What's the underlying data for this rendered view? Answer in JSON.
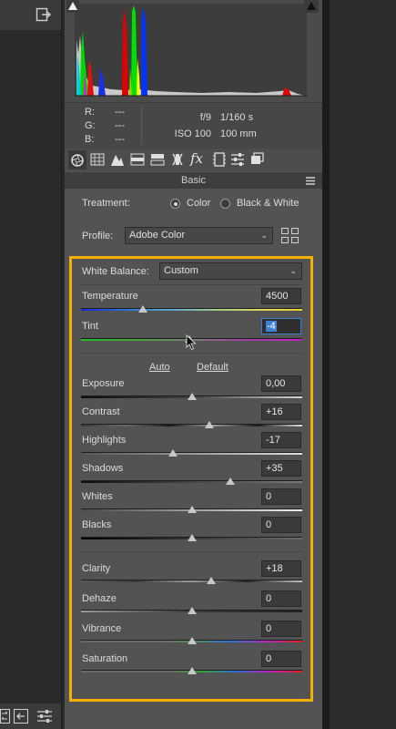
{
  "histogram_info": {
    "r_label": "R:",
    "g_label": "G:",
    "b_label": "B:",
    "r_value": "---",
    "g_value": "---",
    "b_value": "---",
    "aperture": "f/9",
    "shutter": "1/160 s",
    "iso": "ISO 100",
    "focal_length": "100 mm"
  },
  "panel": {
    "title": "Basic"
  },
  "treatment": {
    "label": "Treatment:",
    "color_option": "Color",
    "bw_option": "Black & White",
    "selected": "Color"
  },
  "profile": {
    "label": "Profile:",
    "value": "Adobe Color"
  },
  "white_balance": {
    "label": "White Balance:",
    "value": "Custom"
  },
  "sliders": {
    "temperature": {
      "label": "Temperature",
      "value": "4500",
      "level": 0.28
    },
    "tint": {
      "label": "Tint",
      "value": "-4",
      "level": 0.49
    },
    "exposure": {
      "label": "Exposure",
      "value": "0,00",
      "level": 0.5
    },
    "contrast": {
      "label": "Contrast",
      "value": "+16",
      "level": 0.58
    },
    "highlights": {
      "label": "Highlights",
      "value": "-17",
      "level": 0.415
    },
    "shadows": {
      "label": "Shadows",
      "value": "+35",
      "level": 0.675
    },
    "whites": {
      "label": "Whites",
      "value": "0",
      "level": 0.5
    },
    "blacks": {
      "label": "Blacks",
      "value": "0",
      "level": 0.5
    },
    "clarity": {
      "label": "Clarity",
      "value": "+18",
      "level": 0.59
    },
    "dehaze": {
      "label": "Dehaze",
      "value": "0",
      "level": 0.5
    },
    "vibrance": {
      "label": "Vibrance",
      "value": "0",
      "level": 0.5
    },
    "saturation": {
      "label": "Saturation",
      "value": "0",
      "level": 0.5
    }
  },
  "tone": {
    "auto": "Auto",
    "default": "Default"
  },
  "colors": {
    "highlight_border": "#f4b000",
    "field_focus": "#3d7fd1"
  },
  "icons": [
    "exit-icon",
    "clipping-warning-icon",
    "basic-tab-icon",
    "tone-curve-tab-icon",
    "detail-tab-icon",
    "hsl-tab-icon",
    "split-toning-tab-icon",
    "lens-tab-icon",
    "fx-tab-icon",
    "camera-calibration-tab-icon",
    "presets-tab-icon",
    "snapshots-tab-icon",
    "panel-menu-icon",
    "profile-browser-icon"
  ]
}
